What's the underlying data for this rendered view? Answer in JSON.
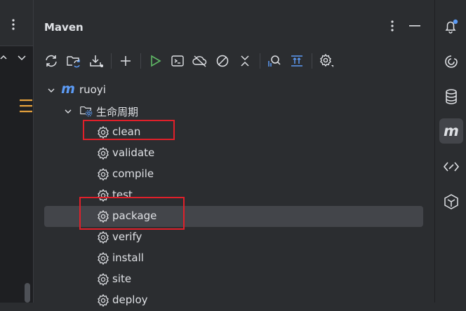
{
  "panel": {
    "title": "Maven"
  },
  "toolbar": {
    "items": [
      "reload-all-projects-icon",
      "generate-sources-icon",
      "download-sources-icon",
      "add-project-icon",
      "run-icon",
      "execute-goal-icon",
      "toggle-offline-icon",
      "skip-tests-icon",
      "collapse-all-icon",
      "show-dependencies-icon",
      "expand-all-icon",
      "settings-icon"
    ]
  },
  "tree": {
    "project": {
      "name": "ruoyi",
      "logo": "m"
    },
    "lifecycle": {
      "label": "生命周期"
    },
    "goals": [
      "clean",
      "validate",
      "compile",
      "test",
      "package",
      "verify",
      "install",
      "site",
      "deploy"
    ],
    "selected_goal": "package"
  },
  "right_sidebar": {
    "items": [
      "notifications-icon",
      "ai-assistant-icon",
      "database-icon",
      "maven-icon",
      "code-with-me-icon",
      "plugin-icon"
    ],
    "active": "maven-icon",
    "maven_glyph": "m"
  },
  "colors": {
    "accent": "#5c9bf5",
    "run_green": "#5fb865",
    "highlight_red": "#e0202a",
    "selected_row": "#43454a"
  }
}
